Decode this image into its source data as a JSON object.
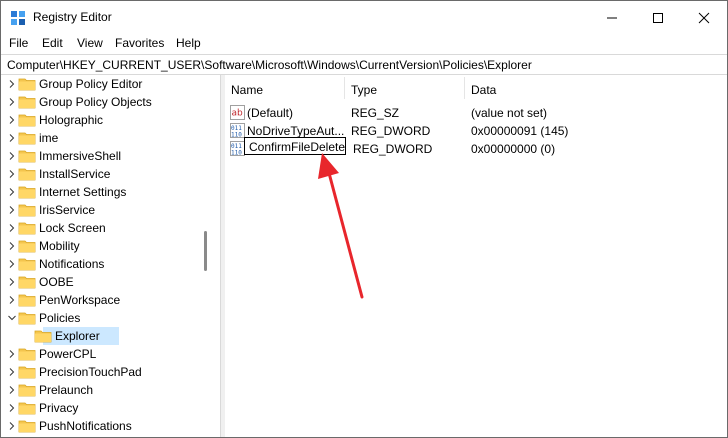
{
  "window": {
    "title": "Registry Editor"
  },
  "menu": [
    "File",
    "Edit",
    "View",
    "Favorites",
    "Help"
  ],
  "address": "Computer\\HKEY_CURRENT_USER\\Software\\Microsoft\\Windows\\CurrentVersion\\Policies\\Explorer",
  "tree": [
    {
      "label": "Group Policy Editor",
      "expanded": false,
      "indent": 0
    },
    {
      "label": "Group Policy Objects",
      "expanded": false,
      "indent": 0
    },
    {
      "label": "Holographic",
      "expanded": false,
      "indent": 0
    },
    {
      "label": "ime",
      "expanded": false,
      "indent": 0
    },
    {
      "label": "ImmersiveShell",
      "expanded": false,
      "indent": 0
    },
    {
      "label": "InstallService",
      "expanded": false,
      "indent": 0
    },
    {
      "label": "Internet Settings",
      "expanded": false,
      "indent": 0
    },
    {
      "label": "IrisService",
      "expanded": false,
      "indent": 0
    },
    {
      "label": "Lock Screen",
      "expanded": false,
      "indent": 0
    },
    {
      "label": "Mobility",
      "expanded": false,
      "indent": 0
    },
    {
      "label": "Notifications",
      "expanded": false,
      "indent": 0
    },
    {
      "label": "OOBE",
      "expanded": false,
      "indent": 0
    },
    {
      "label": "PenWorkspace",
      "expanded": false,
      "indent": 0
    },
    {
      "label": "Policies",
      "expanded": true,
      "indent": 0
    },
    {
      "label": "Explorer",
      "expanded": null,
      "indent": 1,
      "selected": true
    },
    {
      "label": "PowerCPL",
      "expanded": false,
      "indent": 0
    },
    {
      "label": "PrecisionTouchPad",
      "expanded": false,
      "indent": 0
    },
    {
      "label": "Prelaunch",
      "expanded": false,
      "indent": 0
    },
    {
      "label": "Privacy",
      "expanded": false,
      "indent": 0
    },
    {
      "label": "PushNotifications",
      "expanded": false,
      "indent": 0
    }
  ],
  "columns": {
    "name": "Name",
    "type": "Type",
    "data": "Data"
  },
  "values": [
    {
      "name": "(Default)",
      "type": "REG_SZ",
      "data": "(value not set)",
      "icon": "string-value-icon"
    },
    {
      "name": "NoDriveTypeAut...",
      "type": "REG_DWORD",
      "data": "0x00000091 (145)",
      "icon": "binary-value-icon"
    },
    {
      "name": "ConfirmFileDelete",
      "type": "REG_DWORD",
      "data": "0x00000000 (0)",
      "icon": "binary-value-icon",
      "editing": true
    }
  ],
  "colors": {
    "selection": "#cce8ff",
    "folder": "#f4c64f",
    "arrow": "#e8262c"
  }
}
